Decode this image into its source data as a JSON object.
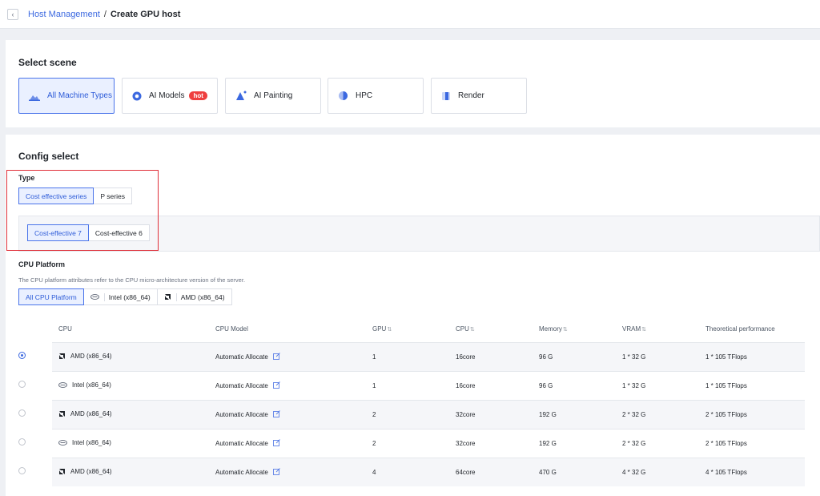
{
  "breadcrumb": {
    "back": "‹",
    "parent": "Host Management",
    "separator": "/",
    "current": "Create GPU host"
  },
  "scene": {
    "title": "Select scene",
    "options": [
      {
        "label": "All Machine Types",
        "icon": "machine-icon",
        "active": true
      },
      {
        "label": "AI Models",
        "icon": "ai-models-icon",
        "badge": "hot"
      },
      {
        "label": "AI Painting",
        "icon": "ai-painting-icon"
      },
      {
        "label": "HPC",
        "icon": "hpc-icon"
      },
      {
        "label": "Render",
        "icon": "render-icon"
      }
    ]
  },
  "config": {
    "title": "Config select",
    "type_label": "Type",
    "types": [
      "Cost effective series",
      "P series"
    ],
    "selected_type": "Cost effective series",
    "generations": [
      "Cost-effective 7",
      "Cost-effective 6"
    ],
    "selected_generation": "Cost-effective 7",
    "cpu_platform_label": "CPU Platform",
    "cpu_platform_desc": "The CPU platform attributes refer to the CPU micro-architecture version of the server.",
    "cpu_platforms": [
      "All CPU Platform",
      "Intel (x86_64)",
      "AMD (x86_64)"
    ],
    "selected_platform": "All CPU Platform"
  },
  "table": {
    "columns": [
      "CPU",
      "CPU Model",
      "GPU",
      "CPU",
      "Memory",
      "VRAM",
      "Theoretical performance"
    ],
    "sortable": [
      false,
      false,
      true,
      true,
      true,
      true,
      false
    ],
    "rows": [
      {
        "cpu": "AMD (x86_64)",
        "vendor": "amd",
        "model": "Automatic Allocate",
        "gpu": "1",
        "cores": "16core",
        "memory": "96 G",
        "vram": "1 * 32 G",
        "perf": "1 * 105 TFlops",
        "selected": true
      },
      {
        "cpu": "Intel (x86_64)",
        "vendor": "intel",
        "model": "Automatic Allocate",
        "gpu": "1",
        "cores": "16core",
        "memory": "96 G",
        "vram": "1 * 32 G",
        "perf": "1 * 105 TFlops",
        "selected": false
      },
      {
        "cpu": "AMD (x86_64)",
        "vendor": "amd",
        "model": "Automatic Allocate",
        "gpu": "2",
        "cores": "32core",
        "memory": "192 G",
        "vram": "2 * 32 G",
        "perf": "2 * 105 TFlops",
        "selected": false
      },
      {
        "cpu": "Intel (x86_64)",
        "vendor": "intel",
        "model": "Automatic Allocate",
        "gpu": "2",
        "cores": "32core",
        "memory": "192 G",
        "vram": "2 * 32 G",
        "perf": "2 * 105 TFlops",
        "selected": false
      },
      {
        "cpu": "AMD (x86_64)",
        "vendor": "amd",
        "model": "Automatic Allocate",
        "gpu": "4",
        "cores": "64core",
        "memory": "470 G",
        "vram": "4 * 32 G",
        "perf": "4 * 105 TFlops",
        "selected": false
      }
    ]
  },
  "colors": {
    "accent": "#3b68e0",
    "hot": "#ee3f3f",
    "highlight": "#e0303a"
  }
}
